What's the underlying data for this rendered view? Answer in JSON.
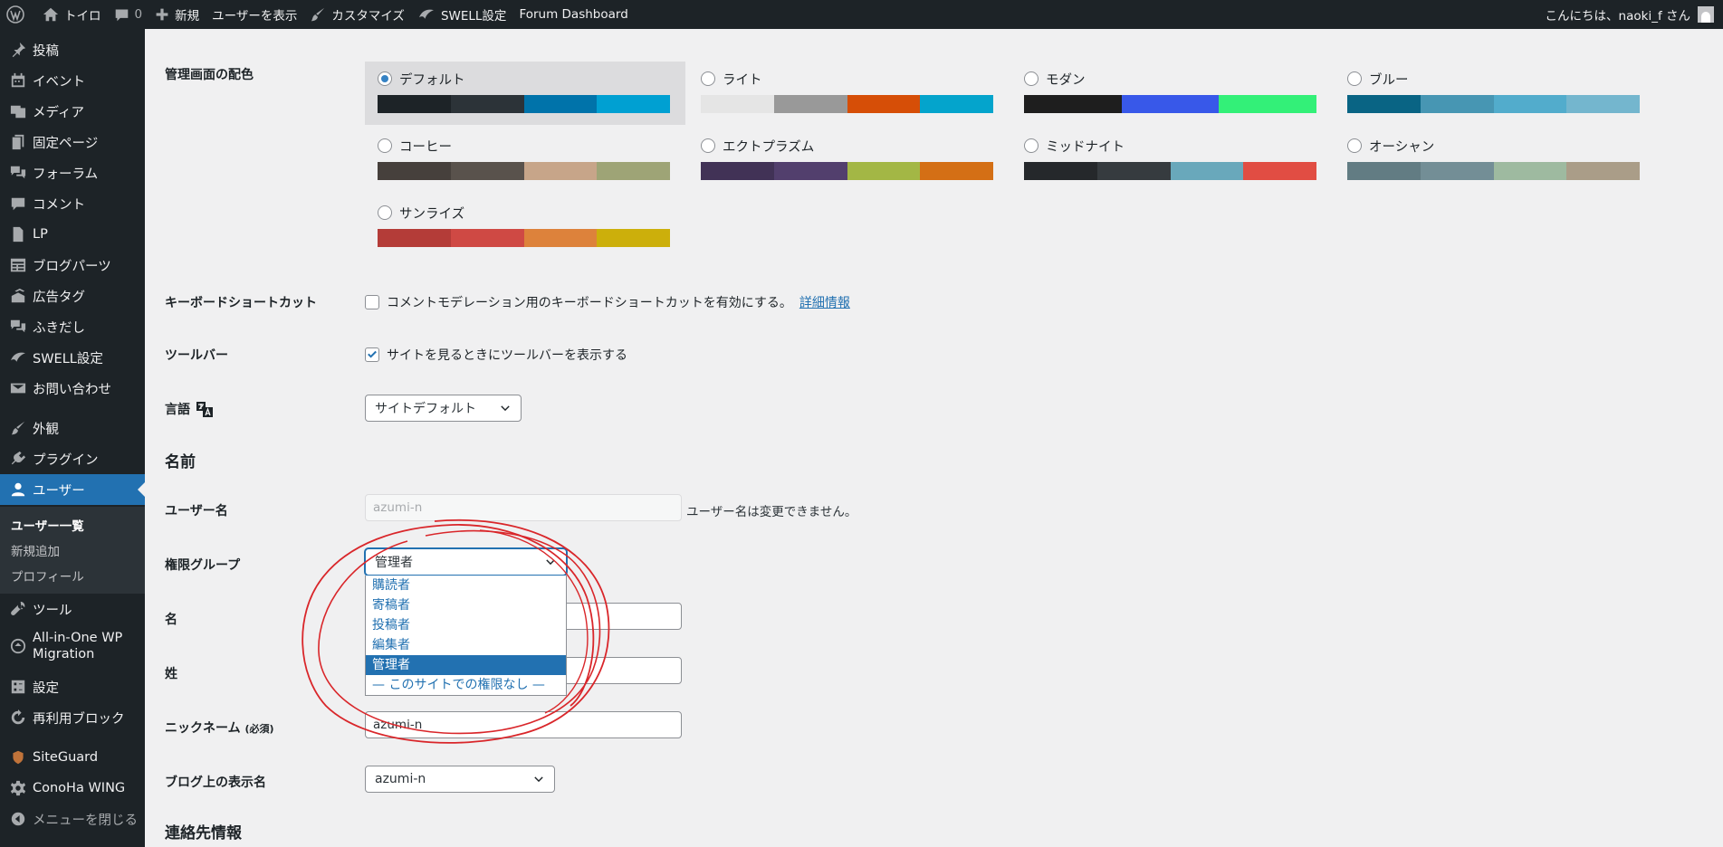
{
  "adminbar": {
    "site_name": "トイロ",
    "comments_count": "0",
    "new_label": "新規",
    "view_user": "ユーザーを表示",
    "customize": "カスタマイズ",
    "swell_settings": "SWELL設定",
    "forum_dashboard": "Forum Dashboard",
    "greeting": "こんにちは、naoki_f さん"
  },
  "sidebar": {
    "items": [
      {
        "label": "投稿",
        "icon": "pin-icon"
      },
      {
        "label": "イベント",
        "icon": "calendar-icon"
      },
      {
        "label": "メディア",
        "icon": "media-icon"
      },
      {
        "label": "固定ページ",
        "icon": "page-icon"
      },
      {
        "label": "フォーラム",
        "icon": "forum-icon"
      },
      {
        "label": "コメント",
        "icon": "comment-icon"
      },
      {
        "label": "LP",
        "icon": "document-icon"
      },
      {
        "label": "ブログパーツ",
        "icon": "table-icon"
      },
      {
        "label": "広告タグ",
        "icon": "stack-icon"
      },
      {
        "label": "ふきだし",
        "icon": "bubbles-icon"
      },
      {
        "label": "SWELL設定",
        "icon": "swell-icon"
      },
      {
        "label": "お問い合わせ",
        "icon": "mail-icon"
      },
      {
        "label": "外観",
        "icon": "brush-icon"
      },
      {
        "label": "プラグイン",
        "icon": "plugin-icon"
      },
      {
        "label": "ユーザー",
        "icon": "user-icon"
      },
      {
        "label": "ツール",
        "icon": "wrench-icon"
      },
      {
        "label": "All-in-One WP Migration",
        "icon": "migration-icon"
      },
      {
        "label": "設定",
        "icon": "settings-icon"
      },
      {
        "label": "再利用ブロック",
        "icon": "reuse-icon"
      },
      {
        "label": "SiteGuard",
        "icon": "shield-icon"
      },
      {
        "label": "ConoHa WING",
        "icon": "gear-icon"
      },
      {
        "label": "メニューを閉じる",
        "icon": "collapse-icon"
      }
    ],
    "submenu": [
      "ユーザー一覧",
      "新規追加",
      "プロフィール"
    ]
  },
  "form": {
    "color_scheme_label": "管理画面の配色",
    "schemes": [
      {
        "name": "デフォルト",
        "colors": [
          "#1d2327",
          "#2c3338",
          "#2271b1",
          "#72aee6"
        ],
        "checked": true
      },
      {
        "name": "ライト",
        "colors": [
          "#e5e5e5",
          "#999999",
          "#d64e07",
          "#04a4cc"
        ],
        "checked": false
      },
      {
        "name": "モダン",
        "colors": [
          "#1e1e1e",
          "#3858e9",
          "#33f078",
          "#33f078"
        ],
        "checked": false
      },
      {
        "name": "ブルー",
        "colors": [
          "#096484",
          "#4796b3",
          "#52accc",
          "#74b6ce"
        ],
        "checked": false
      },
      {
        "name": "コーヒー",
        "colors": [
          "#46403c",
          "#59524c",
          "#c7a589",
          "#9ea476"
        ],
        "checked": false
      },
      {
        "name": "エクトプラズム",
        "colors": [
          "#413256",
          "#523f6d",
          "#a3b745",
          "#d46f15"
        ],
        "checked": false
      },
      {
        "name": "ミッドナイト",
        "colors": [
          "#25282b",
          "#363b3f",
          "#69a8bb",
          "#e14d43"
        ],
        "checked": false
      },
      {
        "name": "オーシャン",
        "colors": [
          "#627c83",
          "#738e96",
          "#9ebaa0",
          "#aa9d88"
        ],
        "checked": false
      },
      {
        "name": "サンライズ",
        "colors": [
          "#b43c38",
          "#cf4944",
          "#dd823b",
          "#ccaf0b"
        ],
        "checked": false
      }
    ],
    "keyboard_label": "キーボードショートカット",
    "keyboard_text": "コメントモデレーション用のキーボードショートカットを有効にする。",
    "keyboard_link": "詳細情報",
    "toolbar_label": "ツールバー",
    "toolbar_text": "サイトを見るときにツールバーを表示する",
    "language_label": "言語",
    "language_value": "サイトデフォルト",
    "name_section": "名前",
    "username_label": "ユーザー名",
    "username_value": "azumi-n",
    "username_note": "ユーザー名は変更できません。",
    "role_label": "権限グループ",
    "role_value": "管理者",
    "role_options": [
      "購読者",
      "寄稿者",
      "投稿者",
      "編集者",
      "管理者",
      "— このサイトでの権限なし —"
    ],
    "first_name_label": "名",
    "last_name_label": "姓",
    "nickname_label": "ニックネーム",
    "nickname_required": "(必須)",
    "nickname_value": "azumi-n",
    "display_name_label": "ブログ上の表示名",
    "display_name_value": "azumi-n",
    "contact_section": "連絡先情報"
  },
  "colors": {
    "annotation": "#d9262a",
    "accent": "#2271b1"
  }
}
